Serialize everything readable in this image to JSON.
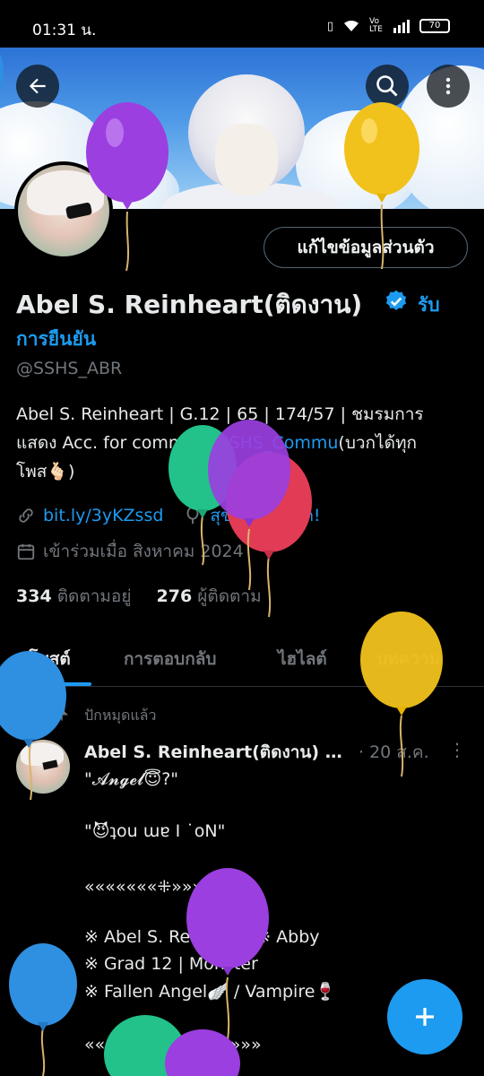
{
  "status_bar": {
    "time": "01:31 น.",
    "network": "Vo LTE",
    "battery": "70"
  },
  "profile": {
    "name": "Abel S. Reinheart(ติดงาน)",
    "verify_prompt_1": "รับ",
    "verify_prompt_2": "การยืนยัน",
    "handle": "@SSHS_ABR",
    "edit_button": "แก้ไขข้อมูลส่วนตัว",
    "bio_line1": "Abel S. Reinheart | G.12 | 65 | 174/57 | ชมรมการ",
    "bio_line2_a": "แสดง Acc. for commu",
    "bio_line2_b": "@SSHS_Commu",
    "bio_line2_c": "(บวกได้ทุก",
    "bio_line3": "โพส🫰🏻)",
    "website": "bit.ly/3yKZssd",
    "birthday": "สุขสันต์วันเกิด!",
    "joined": "เข้าร่วมเมื่อ สิงหาคม 2024",
    "following_count": "334",
    "following_label": "ติดตามอยู่",
    "followers_count": "276",
    "followers_label": "ผู้ติดตาม"
  },
  "tabs": [
    "โพสต์",
    "การตอบกลับ",
    "ไฮไลต์",
    "บทความ"
  ],
  "pinned_label": "ปักหมุดแล้ว",
  "post": {
    "author": "Abel S. Reinheart(ติดงาน)",
    "ellipsis": "…",
    "date": "· 20 ส.ค.",
    "more": "⋮",
    "lines": [
      "\"𝓐𝓷𝓰𝓮𝓵😇?\"",
      "\"😈ʇou ɯɐ I ˙oN\"",
      "«««««««⁜»»»»»»»",
      "※  Abel S. Reinheart ※ Abby",
      "※ Grad 12 | Monster",
      "※ Fallen Angel🪽 / Vampire🍷",
      "««««««««««««»»»»»"
    ]
  },
  "icons": {
    "back": "back-arrow-icon",
    "search": "search-icon",
    "more": "more-vertical-icon",
    "verified": "verified-badge-icon",
    "link": "link-icon",
    "balloon": "balloon-icon",
    "calendar": "calendar-icon",
    "pin": "pin-icon",
    "compose": "plus-icon"
  },
  "colors": {
    "accent": "#1d9bf0",
    "text": "#e7e9ea",
    "muted": "#71767b",
    "background": "#000000"
  }
}
